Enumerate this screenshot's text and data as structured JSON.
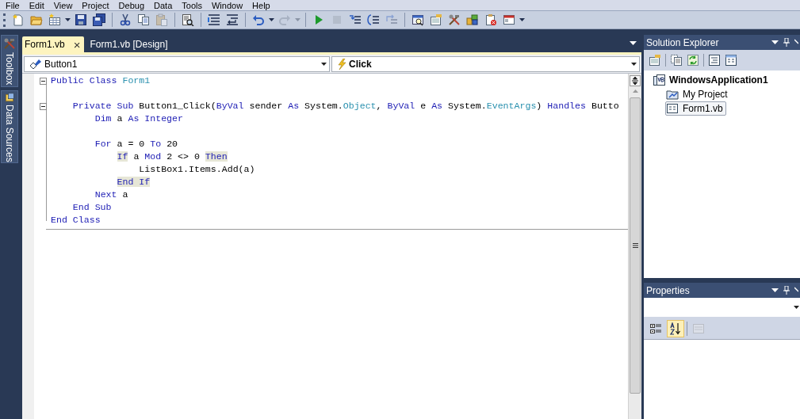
{
  "menu": [
    "File",
    "Edit",
    "View",
    "Project",
    "Debug",
    "Data",
    "Tools",
    "Window",
    "Help"
  ],
  "toolbar": [
    {
      "kind": "button",
      "disabled": false
    },
    {
      "kind": "button",
      "disabled": false
    },
    {
      "kind": "split-button",
      "disabled": false
    },
    {
      "kind": "button",
      "disabled": false
    },
    {
      "kind": "button",
      "disabled": false
    },
    {
      "kind": "separator"
    },
    {
      "kind": "button",
      "disabled": false
    },
    {
      "kind": "button",
      "disabled": false
    },
    {
      "kind": "button",
      "disabled": true
    },
    {
      "kind": "separator"
    },
    {
      "kind": "button",
      "disabled": false
    },
    {
      "kind": "separator"
    },
    {
      "kind": "button",
      "disabled": false
    },
    {
      "kind": "button",
      "disabled": false
    },
    {
      "kind": "separator"
    },
    {
      "kind": "split-button",
      "disabled": false
    },
    {
      "kind": "split-button",
      "disabled": true
    },
    {
      "kind": "separator"
    },
    {
      "kind": "button",
      "disabled": false
    },
    {
      "kind": "button",
      "disabled": true
    },
    {
      "kind": "button",
      "disabled": false
    },
    {
      "kind": "button",
      "disabled": false
    },
    {
      "kind": "button",
      "disabled": true
    },
    {
      "kind": "separator"
    },
    {
      "kind": "button",
      "disabled": false
    },
    {
      "kind": "button",
      "disabled": false
    },
    {
      "kind": "button",
      "disabled": false
    },
    {
      "kind": "button",
      "disabled": false
    },
    {
      "kind": "button",
      "disabled": false
    },
    {
      "kind": "button",
      "disabled": false
    },
    {
      "kind": "overflow"
    }
  ],
  "side_tabs": [
    {
      "label": "Toolbox"
    },
    {
      "label": "Data Sources"
    }
  ],
  "editor_tabs": [
    {
      "label": "Form1.vb",
      "close": "×",
      "selected": true
    },
    {
      "label": "Form1.vb [Design]",
      "selected": false
    }
  ],
  "navigation": {
    "object": "Button1",
    "event": "Click"
  },
  "code": [
    {
      "expanded": true,
      "blank_line_after": true,
      "tokens": [
        {
          "text": "Public Class ",
          "kind": "keyword"
        },
        {
          "text": "Form1",
          "kind": "type"
        }
      ],
      "children": [
        {
          "expanded": true,
          "tokens": [
            {
              "text": "Private Sub",
              "kind": "keyword"
            },
            {
              "text": " Button1_Click(",
              "kind": "plain"
            },
            {
              "text": "ByVal",
              "kind": "keyword"
            },
            {
              "text": " sender ",
              "kind": "plain"
            },
            {
              "text": "As",
              "kind": "keyword"
            },
            {
              "text": " System.",
              "kind": "plain"
            },
            {
              "text": "Object",
              "kind": "type"
            },
            {
              "text": ", ",
              "kind": "plain"
            },
            {
              "text": "ByVal",
              "kind": "keyword"
            },
            {
              "text": " e ",
              "kind": "plain"
            },
            {
              "text": "As",
              "kind": "keyword"
            },
            {
              "text": " System.",
              "kind": "plain"
            },
            {
              "text": "EventArgs",
              "kind": "type"
            },
            {
              "text": ") ",
              "kind": "plain"
            },
            {
              "text": "Handles",
              "kind": "keyword"
            },
            {
              "text": " Butto",
              "kind": "plain"
            }
          ],
          "children": [
            {
              "blank_line_after": true,
              "tokens": [
                {
                  "text": "Dim",
                  "kind": "keyword"
                },
                {
                  "text": " a ",
                  "kind": "plain"
                },
                {
                  "text": "As Integer",
                  "kind": "keyword"
                }
              ]
            },
            {
              "tokens": [
                {
                  "text": "For",
                  "kind": "keyword"
                },
                {
                  "text": " a = 0 ",
                  "kind": "plain"
                },
                {
                  "text": "To",
                  "kind": "keyword"
                },
                {
                  "text": " 20",
                  "kind": "plain"
                }
              ],
              "children": [
                {
                  "tokens": [
                    {
                      "text": "If",
                      "kind": "match"
                    },
                    {
                      "text": " a ",
                      "kind": "plain"
                    },
                    {
                      "text": "Mod",
                      "kind": "keyword"
                    },
                    {
                      "text": " 2 <> 0 ",
                      "kind": "plain"
                    },
                    {
                      "text": "Then",
                      "kind": "match"
                    }
                  ],
                  "children": [
                    {
                      "tokens": [
                        {
                          "text": "ListBox1.Items.Add(a)",
                          "kind": "plain"
                        }
                      ]
                    }
                  ]
                },
                {
                  "tokens": [
                    {
                      "text": "End If",
                      "kind": "match"
                    }
                  ]
                }
              ]
            },
            {
              "tokens": [
                {
                  "text": "Next",
                  "kind": "keyword"
                },
                {
                  "text": " a",
                  "kind": "plain"
                }
              ]
            }
          ]
        },
        {
          "tokens": [
            {
              "text": "End Sub",
              "kind": "keyword"
            }
          ]
        }
      ]
    },
    {
      "tokens": [
        {
          "text": "End Class",
          "kind": "keyword"
        }
      ]
    }
  ],
  "solution_explorer": {
    "title": "Solution Explorer",
    "toolbar": [
      {
        "kind": "button"
      },
      {
        "kind": "separator"
      },
      {
        "kind": "button"
      },
      {
        "kind": "button"
      },
      {
        "kind": "separator"
      },
      {
        "kind": "button"
      },
      {
        "kind": "button"
      }
    ],
    "tree": [
      {
        "label": "WindowsApplication1",
        "selected": false,
        "children": [
          {
            "label": "My Project",
            "selected": false
          },
          {
            "label": "Form1.vb",
            "selected": true
          }
        ]
      }
    ]
  },
  "properties": {
    "title": "Properties",
    "toolbar": [
      {
        "selected": false,
        "disabled": false
      },
      {
        "selected": true,
        "disabled": false
      },
      {
        "selected": false,
        "disabled": true
      }
    ]
  }
}
